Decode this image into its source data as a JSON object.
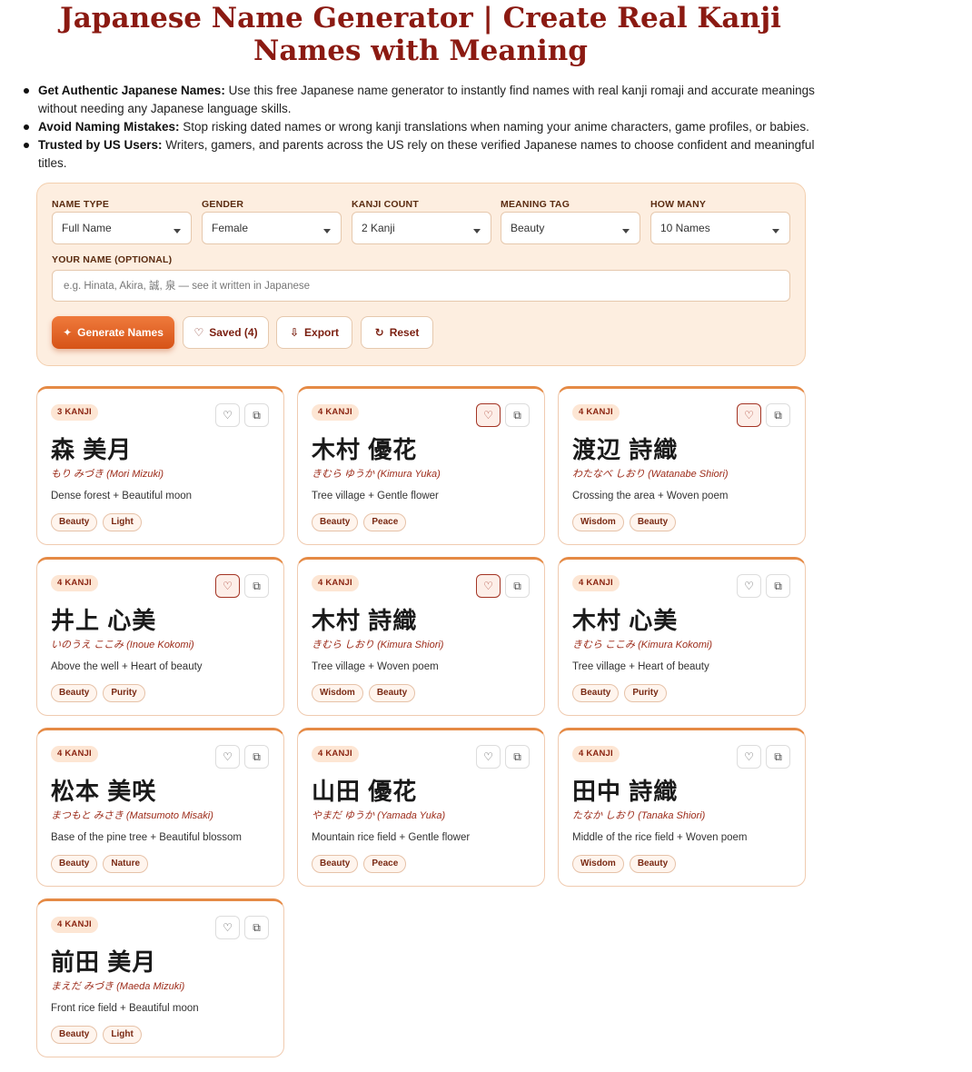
{
  "page": {
    "title": "Japanese Name Generator | Create Real Kanji Names with Meaning",
    "bullets": [
      {
        "lead": "Get Authentic Japanese Names:",
        "text": " Use this free Japanese name generator to instantly find names with real kanji romaji and accurate meanings without needing any Japanese language skills."
      },
      {
        "lead": "Avoid Naming Mistakes:",
        "text": " Stop risking dated names or wrong kanji translations when naming your anime characters, game profiles, or babies."
      },
      {
        "lead": "Trusted by US Users:",
        "text": " Writers, gamers, and parents across the US rely on these verified Japanese names to choose confident and meaningful titles."
      }
    ]
  },
  "form": {
    "name_type": {
      "label": "NAME TYPE",
      "value": "Full Name"
    },
    "gender": {
      "label": "GENDER",
      "value": "Female"
    },
    "kanji_count": {
      "label": "KANJI COUNT",
      "value": "2 Kanji"
    },
    "meaning_tag": {
      "label": "MEANING TAG",
      "value": "Beauty"
    },
    "how_many": {
      "label": "HOW MANY",
      "value": "10 Names"
    },
    "your_name": {
      "label": "YOUR NAME (OPTIONAL)",
      "placeholder": "e.g. Hinata, Akira, 誠, 泉 — see it written in Japanese",
      "value": ""
    },
    "buttons": {
      "generate": "Generate Names",
      "saved": "Saved (4)",
      "export": "Export",
      "reset": "Reset"
    }
  },
  "results": [
    {
      "badge": "3 KANJI",
      "kanji": "森 美月",
      "reading": "もり みづき (Mori Mizuki)",
      "meaning": "Dense forest + Beautiful moon",
      "tags": [
        "Beauty",
        "Light"
      ],
      "saved": false
    },
    {
      "badge": "4 KANJI",
      "kanji": "木村 優花",
      "reading": "きむら ゆうか (Kimura Yuka)",
      "meaning": "Tree village + Gentle flower",
      "tags": [
        "Beauty",
        "Peace"
      ],
      "saved": true
    },
    {
      "badge": "4 KANJI",
      "kanji": "渡辺 詩織",
      "reading": "わたなべ しおり (Watanabe Shiori)",
      "meaning": "Crossing the area + Woven poem",
      "tags": [
        "Wisdom",
        "Beauty"
      ],
      "saved": true
    },
    {
      "badge": "4 KANJI",
      "kanji": "井上 心美",
      "reading": "いのうえ ここみ (Inoue Kokomi)",
      "meaning": "Above the well + Heart of beauty",
      "tags": [
        "Beauty",
        "Purity"
      ],
      "saved": true
    },
    {
      "badge": "4 KANJI",
      "kanji": "木村 詩織",
      "reading": "きむら しおり (Kimura Shiori)",
      "meaning": "Tree village + Woven poem",
      "tags": [
        "Wisdom",
        "Beauty"
      ],
      "saved": true
    },
    {
      "badge": "4 KANJI",
      "kanji": "木村 心美",
      "reading": "きむら ここみ (Kimura Kokomi)",
      "meaning": "Tree village + Heart of beauty",
      "tags": [
        "Beauty",
        "Purity"
      ],
      "saved": false
    },
    {
      "badge": "4 KANJI",
      "kanji": "松本 美咲",
      "reading": "まつもと みさき (Matsumoto Misaki)",
      "meaning": "Base of the pine tree + Beautiful blossom",
      "tags": [
        "Beauty",
        "Nature"
      ],
      "saved": false
    },
    {
      "badge": "4 KANJI",
      "kanji": "山田 優花",
      "reading": "やまだ ゆうか (Yamada Yuka)",
      "meaning": "Mountain rice field + Gentle flower",
      "tags": [
        "Beauty",
        "Peace"
      ],
      "saved": false
    },
    {
      "badge": "4 KANJI",
      "kanji": "田中 詩織",
      "reading": "たなか しおり (Tanaka Shiori)",
      "meaning": "Middle of the rice field + Woven poem",
      "tags": [
        "Wisdom",
        "Beauty"
      ],
      "saved": false
    },
    {
      "badge": "4 KANJI",
      "kanji": "前田 美月",
      "reading": "まえだ みづき (Maeda Mizuki)",
      "meaning": "Front rice field + Beautiful moon",
      "tags": [
        "Beauty",
        "Light"
      ],
      "saved": false
    }
  ],
  "icons": {
    "generate": "sparkle-icon",
    "saved": "heart-icon",
    "export": "download-icon",
    "reset": "refresh-icon",
    "card_save": "heart-icon",
    "card_copy": "copy-icon"
  },
  "colors": {
    "title": "#8b1a12",
    "accent": "#e07030",
    "panel_bg": "#fdeee0",
    "card_border_top": "#e58a45"
  }
}
